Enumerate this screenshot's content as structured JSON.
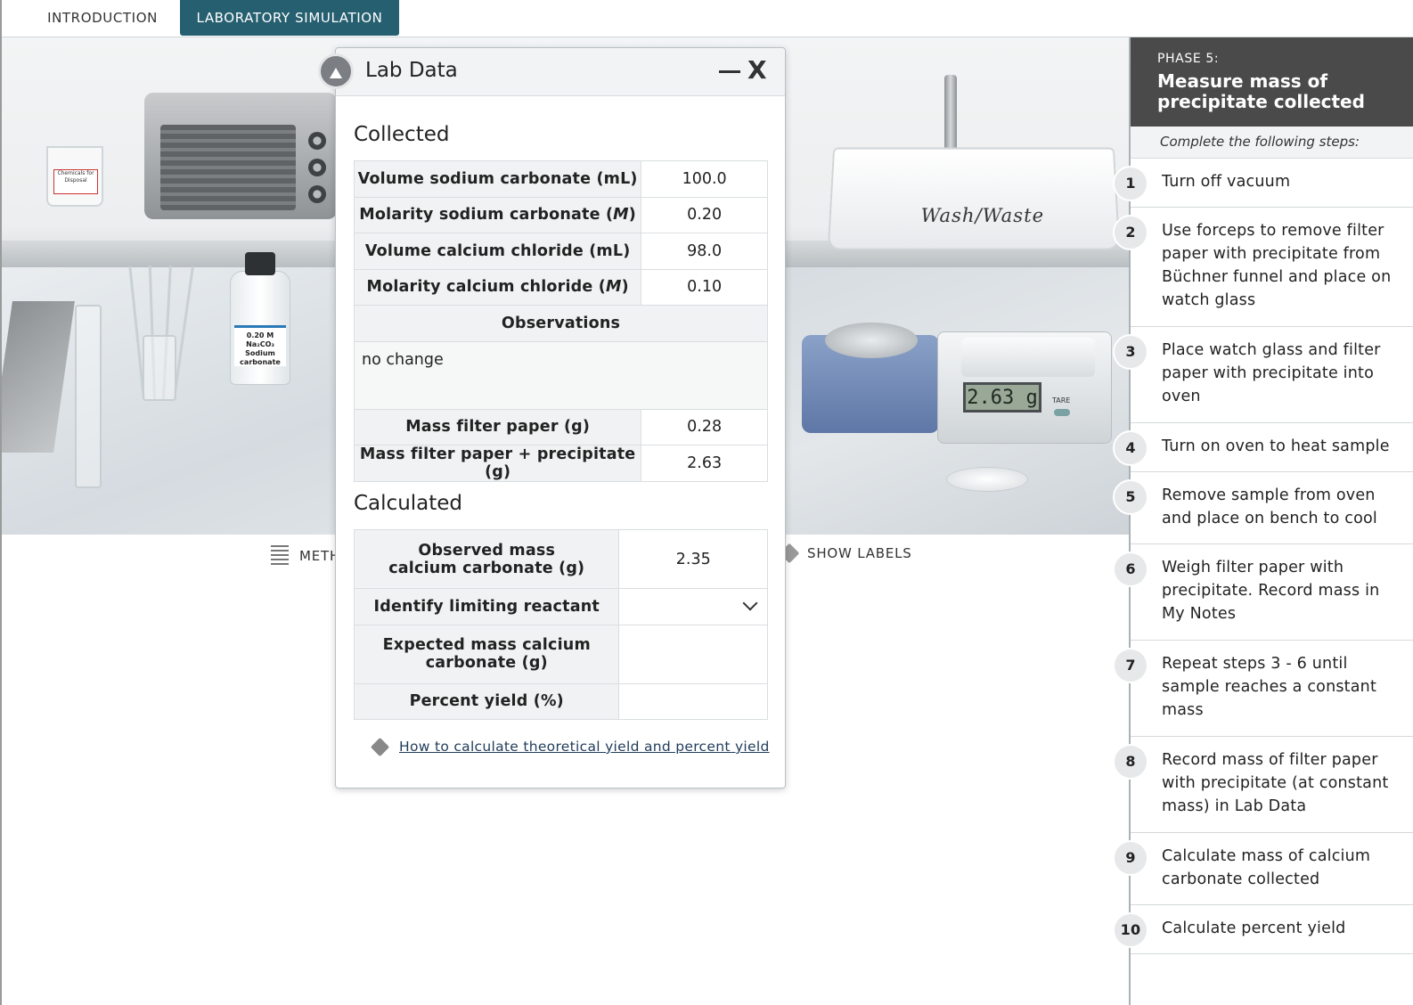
{
  "tabs": [
    {
      "label": "INTRODUCTION"
    },
    {
      "label": "LABORATORY SIMULATION"
    }
  ],
  "scene": {
    "tray_label": "Wash/Waste",
    "bottle_label": "0.20 M Na₂CO₃ Sodium carbonate",
    "beaker_label": "Chemicals for Disposal",
    "balance_readout": "2.63 g",
    "balance_tare": "TARE",
    "toolbar": {
      "methods_label": "METH",
      "show_labels": "SHOW LABELS"
    }
  },
  "sidebar": {
    "phase": "PHASE 5:",
    "title": "Measure mass of precipitate collected",
    "subtitle": "Complete the following steps:",
    "steps": [
      {
        "num": "1",
        "text": "Turn off vacuum"
      },
      {
        "num": "2",
        "text": "Use forceps to remove filter paper with precipitate from Büchner funnel and place on watch glass"
      },
      {
        "num": "3",
        "text": "Place watch glass and filter paper with precipitate into oven"
      },
      {
        "num": "4",
        "text": "Turn on oven to heat sample"
      },
      {
        "num": "5",
        "text": "Remove sample from oven and place on bench to cool"
      },
      {
        "num": "6",
        "text": "Weigh filter paper with precipitate. Record mass in My Notes"
      },
      {
        "num": "7",
        "text": "Repeat steps 3 - 6 until sample reaches a constant mass"
      },
      {
        "num": "8",
        "text": "Record mass of filter paper with precipitate (at constant mass) in Lab Data"
      },
      {
        "num": "9",
        "text": "Calculate mass of calcium carbonate collected"
      },
      {
        "num": "10",
        "text": "Calculate percent yield"
      }
    ]
  },
  "dialog": {
    "title": "Lab Data",
    "collected_title": "Collected",
    "collected": [
      {
        "label_pre": "Volume sodium carbonate (mL)",
        "label_italic": "",
        "label_post": "",
        "value": "100.0"
      },
      {
        "label_pre": "Molarity sodium carbonate (",
        "label_italic": "M",
        "label_post": ")",
        "value": "0.20"
      },
      {
        "label_pre": "Volume calcium chloride (mL)",
        "label_italic": "",
        "label_post": "",
        "value": "98.0"
      },
      {
        "label_pre": "Molarity calcium chloride (",
        "label_italic": "M",
        "label_post": ")",
        "value": "0.10"
      }
    ],
    "observations_label": "Observations",
    "observations_value": "no change",
    "masses": [
      {
        "label": "Mass filter paper (g)",
        "value": "0.28"
      },
      {
        "label": "Mass filter paper + precipitate (g)",
        "value": "2.63"
      }
    ],
    "calculated_title": "Calculated",
    "calculated": [
      {
        "label": "Observed mass calcium carbonate (g)",
        "value": "2.35"
      },
      {
        "label": "Identify limiting reactant",
        "value": ""
      },
      {
        "label": "Expected mass calcium carbonate (g)",
        "value": ""
      },
      {
        "label": "Percent yield (%)",
        "value": ""
      }
    ],
    "help_link": "How to calculate theoretical yield and percent yield"
  }
}
